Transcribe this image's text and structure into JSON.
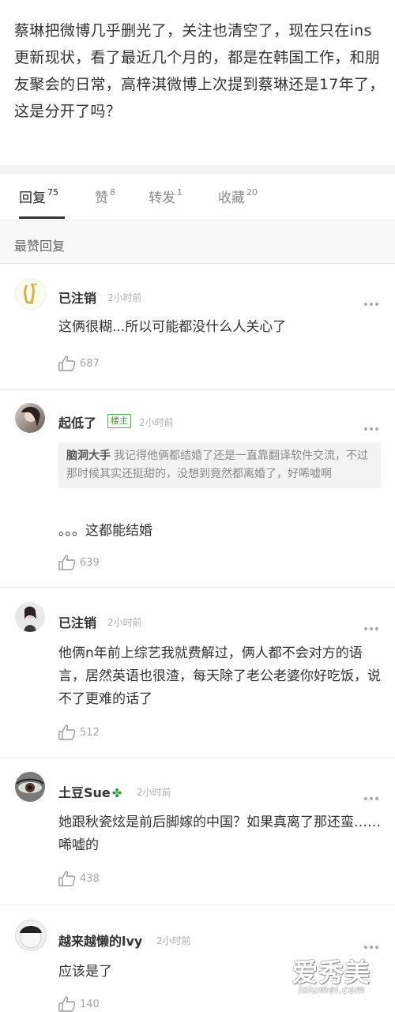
{
  "post": {
    "text": "蔡琳把微博几乎删光了，关注也清空了，现在只在ins更新现状，看了最近几个月的，都是在韩国工作，和朋友聚会的日常，高梓淇微博上次提到蔡琳还是17年了，这是分开了吗？"
  },
  "tabs": [
    {
      "label": "回复",
      "count": "75"
    },
    {
      "label": "赞",
      "count": "8"
    },
    {
      "label": "转发",
      "count": "1"
    },
    {
      "label": "收藏",
      "count": "20"
    }
  ],
  "section_title": "最赞回复",
  "comments": [
    {
      "username": "已注销",
      "time": "2小时前",
      "text": "这俩很糊...所以可能都没什么人关心了",
      "likes": "687"
    },
    {
      "username": "起低了",
      "badge": "楼主",
      "time": "2小时前",
      "quote_author": "脑洞大手",
      "quote_text": "我记得他俩都结婚了还是一直靠翻译软件交流，不过那时候其实还挺甜的，没想到竟然都离婚了，好唏嘘啊",
      "text": "。。。这都能结婚",
      "likes": "639"
    },
    {
      "username": "已注销",
      "time": "2小时前",
      "text": "他俩n年前上综艺我就费解过，俩人都不会对方的语言，居然英语也很渣，每天除了老公老婆你好吃饭，说不了更难的话了",
      "likes": "512"
    },
    {
      "username": "土豆Sue",
      "time": "2小时前",
      "text": "她跟秋瓷炫是前后脚嫁的中国？如果真离了那还蛮……唏嘘的",
      "likes": "438"
    },
    {
      "username": "越来越懒的lvy",
      "time": "2小时前",
      "text": "应该是了",
      "likes": "140"
    }
  ],
  "watermark": {
    "main": "爱秀美",
    "sub": "ixiumei.com"
  },
  "colors": {
    "separator": "#f2f2f2",
    "badge_green": "#3a9a3a",
    "clover_green": "#2e9b3a"
  }
}
